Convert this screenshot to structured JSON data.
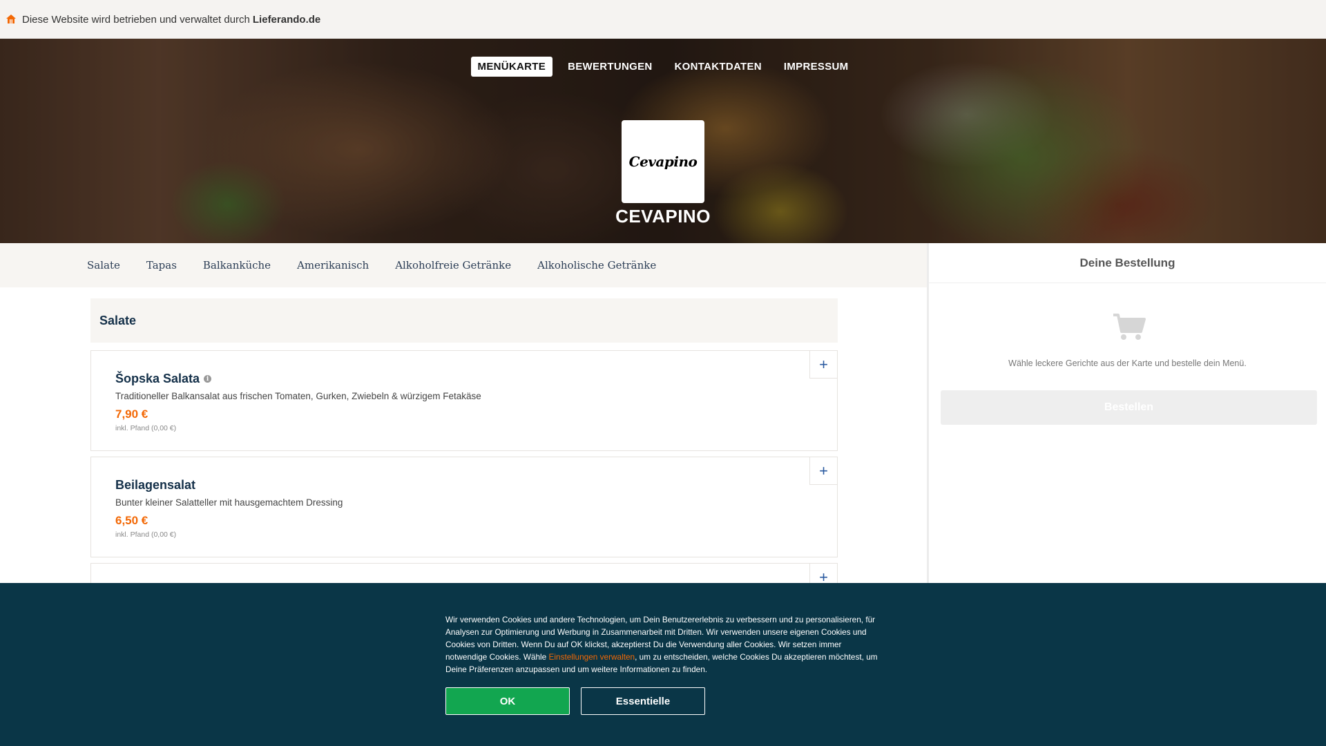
{
  "topbar": {
    "prefix": "Diese Website wird betrieben und verwaltet durch",
    "brand": "Lieferando.de"
  },
  "hero": {
    "nav": [
      "MENÜKARTE",
      "BEWERTUNGEN",
      "KONTAKTDATEN",
      "IMPRESSUM"
    ],
    "logo_text": "Cevapino",
    "restaurant_name": "CEVAPINO"
  },
  "categories": [
    "Salate",
    "Tapas",
    "Balkanküche",
    "Amerikanisch",
    "Alkoholfreie Getränke",
    "Alkoholische Getränke"
  ],
  "menu": {
    "section_title": "Salate",
    "add_symbol": "+",
    "items": [
      {
        "name": "Šopska Salata",
        "desc": "Traditioneller Balkansalat aus frischen Tomaten, Gurken, Zwiebeln & würzigem Fetakäse",
        "price": "7,90 €",
        "deposit": "inkl. Pfand (0,00 €)"
      },
      {
        "name": "Beilagensalat",
        "desc": "Bunter kleiner Salatteller mit hausgemachtem Dressing",
        "price": "6,50 €",
        "deposit": "inkl. Pfand (0,00 €)"
      }
    ]
  },
  "basket": {
    "title": "Deine Bestellung",
    "hint": "Wähle leckere Gerichte aus der Karte und bestelle dein Menü.",
    "order_label": "Bestellen"
  },
  "cookie": {
    "text_before": "Wir verwenden Cookies und andere Technologien, um Dein Benutzererlebnis zu verbessern und zu personalisieren, für Analysen zur Optimierung und Werbung in Zusammenarbeit mit Dritten. Wir verwenden unsere eigenen Cookies und Cookies von Dritten. Wenn Du auf OK klickst, akzeptierst Du die Verwendung aller Cookies. Wir setzen immer notwendige Cookies. Wähle ",
    "link": "Einstellungen verwalten",
    "text_after": ", um zu entscheiden, welche Cookies Du akzeptieren möchtest, um Deine Präferenzen anzupassen und um weitere Informationen zu finden.",
    "ok_label": "OK",
    "essential_label": "Essentielle"
  },
  "colors": {
    "accent": "#f36805",
    "navy": "#143049",
    "banner": "#0a3647",
    "ok_green": "#12a650"
  }
}
